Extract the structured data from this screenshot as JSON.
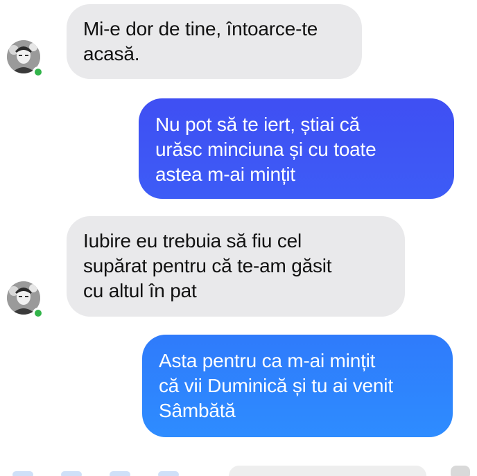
{
  "conversation": {
    "messages": [
      {
        "direction": "incoming",
        "text": "Mi-e dor de tine, întoarce-te\nacasă."
      },
      {
        "direction": "outgoing",
        "text": "Nu pot să te iert, știai că\nurăsc minciuna și cu toate\nastea m-ai mințit"
      },
      {
        "direction": "incoming",
        "text": "Iubire eu trebuia să fiu cel\nsupărat pentru că te-am găsit\ncu altul în pat"
      },
      {
        "direction": "outgoing",
        "text": "Asta pentru ca m-ai mințit\ncă vii Duminică și tu ai venit\nSâmbătă"
      }
    ]
  },
  "contact": {
    "avatar_icon": "profile-photo",
    "presence_status": "active",
    "presence_color": "#32b44a"
  },
  "colors": {
    "incoming_bubble": "#e9e9eb",
    "outgoing_bubble_1": "#3f4ff3",
    "outgoing_bubble_2": "#2e8cff",
    "outgoing_text": "#ffffff",
    "incoming_text": "#111111"
  }
}
